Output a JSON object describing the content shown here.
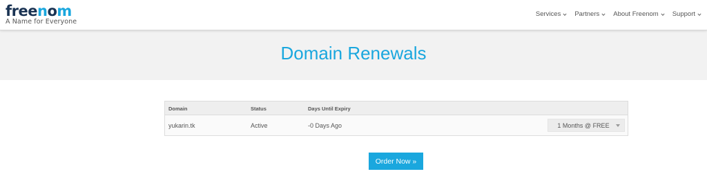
{
  "brand": {
    "logo_part1": "free",
    "logo_part2": "n",
    "logo_part3": "o",
    "logo_part4": "m",
    "tagline": "A Name for Everyone",
    "colors": {
      "dark": "#1a3353",
      "accent": "#1aa7de"
    }
  },
  "nav": {
    "items": [
      {
        "label": "Services"
      },
      {
        "label": "Partners"
      },
      {
        "label": "About Freenom"
      },
      {
        "label": "Support"
      }
    ]
  },
  "page": {
    "title": "Domain Renewals"
  },
  "table": {
    "headers": {
      "domain": "Domain",
      "status": "Status",
      "days": "Days Until Expiry"
    },
    "rows": [
      {
        "domain": "yukarin.tk",
        "status": "Active",
        "days": "-0 Days Ago",
        "period": "1 Months @ FREE"
      }
    ]
  },
  "actions": {
    "order_label": "Order Now »"
  }
}
